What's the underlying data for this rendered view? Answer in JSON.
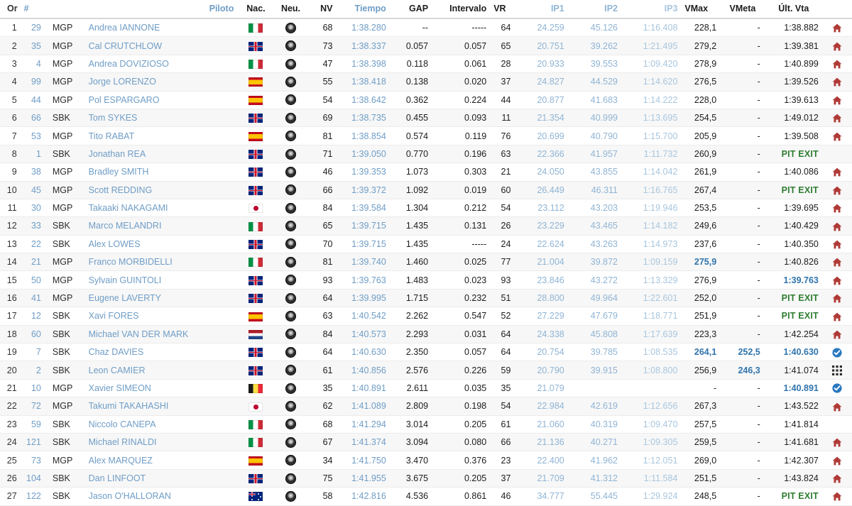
{
  "table": {
    "columns": [
      {
        "key": "or",
        "label": "Or"
      },
      {
        "key": "number",
        "label": "#"
      },
      {
        "key": "category",
        "label": ""
      },
      {
        "key": "pilot",
        "label": "Piloto"
      },
      {
        "key": "nac",
        "label": "Nac."
      },
      {
        "key": "neu",
        "label": "Neu."
      },
      {
        "key": "nv",
        "label": "NV"
      },
      {
        "key": "tiempo",
        "label": "Tiempo"
      },
      {
        "key": "gap",
        "label": "GAP"
      },
      {
        "key": "intervalo",
        "label": "Intervalo"
      },
      {
        "key": "vr",
        "label": "VR"
      },
      {
        "key": "ip1",
        "label": "IP1"
      },
      {
        "key": "ip2",
        "label": "IP2"
      },
      {
        "key": "ip3",
        "label": "IP3"
      },
      {
        "key": "vmax",
        "label": "VMax"
      },
      {
        "key": "vmeta",
        "label": "VMeta"
      },
      {
        "key": "ult",
        "label": "Últ. Vta"
      },
      {
        "key": "status",
        "label": ""
      }
    ],
    "rows": [
      {
        "or": "1",
        "number": "29",
        "category": "MGP",
        "pilot": "Andrea IANNONE",
        "nac": "it",
        "neu": "tyre-icon",
        "nv": "68",
        "tiempo": "1:38.280",
        "gap": "--",
        "intervalo": "-----",
        "vr": "64",
        "ip1": "24.259",
        "ip2": "45.126",
        "ip3": "1:16.408",
        "vmax": "228,1",
        "vmeta": "-",
        "ult": "1:38.882",
        "ult_style": "normal",
        "status": "home-icon"
      },
      {
        "or": "2",
        "number": "35",
        "category": "MGP",
        "pilot": "Cal CRUTCHLOW",
        "nac": "gb",
        "neu": "tyre-icon",
        "nv": "73",
        "tiempo": "1:38.337",
        "gap": "0.057",
        "intervalo": "0.057",
        "vr": "65",
        "ip1": "20.751",
        "ip2": "39.262",
        "ip3": "1:21.495",
        "vmax": "279,2",
        "vmeta": "-",
        "ult": "1:39.381",
        "ult_style": "normal",
        "status": "home-icon"
      },
      {
        "or": "3",
        "number": "4",
        "category": "MGP",
        "pilot": "Andrea DOVIZIOSO",
        "nac": "it",
        "neu": "tyre-icon",
        "nv": "47",
        "tiempo": "1:38.398",
        "gap": "0.118",
        "intervalo": "0.061",
        "vr": "28",
        "ip1": "20.933",
        "ip2": "39.553",
        "ip3": "1:09.420",
        "vmax": "278,9",
        "vmeta": "-",
        "ult": "1:40.899",
        "ult_style": "normal",
        "status": "home-icon"
      },
      {
        "or": "4",
        "number": "99",
        "category": "MGP",
        "pilot": "Jorge LORENZO",
        "nac": "es",
        "neu": "tyre-icon",
        "nv": "55",
        "tiempo": "1:38.418",
        "gap": "0.138",
        "intervalo": "0.020",
        "vr": "37",
        "ip1": "24.827",
        "ip2": "44.529",
        "ip3": "1:14.620",
        "vmax": "276,5",
        "vmeta": "-",
        "ult": "1:39.526",
        "ult_style": "normal",
        "status": "home-icon"
      },
      {
        "or": "5",
        "number": "44",
        "category": "MGP",
        "pilot": "Pol ESPARGARO",
        "nac": "es",
        "neu": "tyre-icon",
        "nv": "54",
        "tiempo": "1:38.642",
        "gap": "0.362",
        "intervalo": "0.224",
        "vr": "44",
        "ip1": "20.877",
        "ip2": "41.683",
        "ip3": "1:14.222",
        "vmax": "228,0",
        "vmeta": "-",
        "ult": "1:39.613",
        "ult_style": "normal",
        "status": "home-icon"
      },
      {
        "or": "6",
        "number": "66",
        "category": "SBK",
        "pilot": "Tom SYKES",
        "nac": "gb",
        "neu": "tyre-icon",
        "nv": "69",
        "tiempo": "1:38.735",
        "gap": "0.455",
        "intervalo": "0.093",
        "vr": "11",
        "ip1": "21.354",
        "ip2": "40.999",
        "ip3": "1:13.695",
        "vmax": "254,5",
        "vmeta": "-",
        "ult": "1:49.012",
        "ult_style": "normal",
        "status": "home-icon"
      },
      {
        "or": "7",
        "number": "53",
        "category": "MGP",
        "pilot": "Tito RABAT",
        "nac": "es",
        "neu": "tyre-icon",
        "nv": "81",
        "tiempo": "1:38.854",
        "gap": "0.574",
        "intervalo": "0.119",
        "vr": "76",
        "ip1": "20.699",
        "ip2": "40.790",
        "ip3": "1:15.700",
        "vmax": "205,9",
        "vmeta": "-",
        "ult": "1:39.508",
        "ult_style": "normal",
        "status": "home-icon"
      },
      {
        "or": "8",
        "number": "1",
        "category": "SBK",
        "pilot": "Jonathan REA",
        "nac": "gb",
        "neu": "tyre-icon",
        "nv": "71",
        "tiempo": "1:39.050",
        "gap": "0.770",
        "intervalo": "0.196",
        "vr": "63",
        "ip1": "22.366",
        "ip2": "41.957",
        "ip3": "1:11.732",
        "vmax": "260,9",
        "vmeta": "-",
        "ult": "PIT EXIT",
        "ult_style": "pit",
        "status": "none"
      },
      {
        "or": "9",
        "number": "38",
        "category": "MGP",
        "pilot": "Bradley SMITH",
        "nac": "gb",
        "neu": "tyre-icon",
        "nv": "46",
        "tiempo": "1:39.353",
        "gap": "1.073",
        "intervalo": "0.303",
        "vr": "21",
        "ip1": "24.050",
        "ip2": "43.855",
        "ip3": "1:14.042",
        "vmax": "261,9",
        "vmeta": "-",
        "ult": "1:40.086",
        "ult_style": "normal",
        "status": "home-icon"
      },
      {
        "or": "10",
        "number": "45",
        "category": "MGP",
        "pilot": "Scott REDDING",
        "nac": "gb",
        "neu": "tyre-icon",
        "nv": "66",
        "tiempo": "1:39.372",
        "gap": "1.092",
        "intervalo": "0.019",
        "vr": "60",
        "ip1": "26.449",
        "ip2": "46.311",
        "ip3": "1:16.765",
        "vmax": "267,4",
        "vmeta": "-",
        "ult": "PIT EXIT",
        "ult_style": "pit",
        "status": "home-icon"
      },
      {
        "or": "11",
        "number": "30",
        "category": "MGP",
        "pilot": "Takaaki NAKAGAMI",
        "nac": "jp",
        "neu": "tyre-icon",
        "nv": "84",
        "tiempo": "1:39.584",
        "gap": "1.304",
        "intervalo": "0.212",
        "vr": "54",
        "ip1": "23.112",
        "ip2": "43.203",
        "ip3": "1:19.946",
        "vmax": "253,5",
        "vmeta": "-",
        "ult": "1:39.695",
        "ult_style": "normal",
        "status": "home-icon"
      },
      {
        "or": "12",
        "number": "33",
        "category": "SBK",
        "pilot": "Marco MELANDRI",
        "nac": "it",
        "neu": "tyre-icon",
        "nv": "65",
        "tiempo": "1:39.715",
        "gap": "1.435",
        "intervalo": "0.131",
        "vr": "26",
        "ip1": "23.229",
        "ip2": "43.465",
        "ip3": "1:14.182",
        "vmax": "249,6",
        "vmeta": "-",
        "ult": "1:40.429",
        "ult_style": "normal",
        "status": "home-icon"
      },
      {
        "or": "13",
        "number": "22",
        "category": "SBK",
        "pilot": "Alex LOWES",
        "nac": "gb",
        "neu": "tyre-icon",
        "nv": "70",
        "tiempo": "1:39.715",
        "gap": "1.435",
        "intervalo": "-----",
        "vr": "24",
        "ip1": "22.624",
        "ip2": "43.263",
        "ip3": "1:14.973",
        "vmax": "237,6",
        "vmeta": "-",
        "ult": "1:40.350",
        "ult_style": "normal",
        "status": "home-icon"
      },
      {
        "or": "14",
        "number": "21",
        "category": "MGP",
        "pilot": "Franco MORBIDELLI",
        "nac": "it",
        "neu": "tyre-icon",
        "nv": "81",
        "tiempo": "1:39.740",
        "gap": "1.460",
        "intervalo": "0.025",
        "vr": "77",
        "ip1": "21.004",
        "ip2": "39.872",
        "ip3": "1:09.159",
        "vmax": "275,9",
        "vmax_style": "bold",
        "vmeta": "-",
        "ult": "1:40.826",
        "ult_style": "normal",
        "status": "home-icon"
      },
      {
        "or": "15",
        "number": "50",
        "category": "MGP",
        "pilot": "Sylvain GUINTOLI",
        "nac": "gb",
        "neu": "tyre-icon",
        "nv": "93",
        "tiempo": "1:39.763",
        "gap": "1.483",
        "intervalo": "0.023",
        "vr": "93",
        "ip1": "23.846",
        "ip2": "43.272",
        "ip3": "1:13.329",
        "vmax": "276,9",
        "vmeta": "-",
        "ult": "1:39.763",
        "ult_style": "bold",
        "status": "home-icon"
      },
      {
        "or": "16",
        "number": "41",
        "category": "MGP",
        "pilot": "Eugene LAVERTY",
        "nac": "gb",
        "neu": "tyre-icon",
        "nv": "64",
        "tiempo": "1:39.995",
        "gap": "1.715",
        "intervalo": "0.232",
        "vr": "51",
        "ip1": "28.800",
        "ip2": "49.964",
        "ip3": "1:22.601",
        "vmax": "252,0",
        "vmeta": "-",
        "ult": "PIT EXIT",
        "ult_style": "pit",
        "status": "home-icon"
      },
      {
        "or": "17",
        "number": "12",
        "category": "SBK",
        "pilot": "Xavi FORES",
        "nac": "es",
        "neu": "tyre-icon",
        "nv": "63",
        "tiempo": "1:40.542",
        "gap": "2.262",
        "intervalo": "0.547",
        "vr": "52",
        "ip1": "27.229",
        "ip2": "47.679",
        "ip3": "1:18.771",
        "vmax": "251,9",
        "vmeta": "-",
        "ult": "PIT EXIT",
        "ult_style": "pit",
        "status": "home-icon"
      },
      {
        "or": "18",
        "number": "60",
        "category": "SBK",
        "pilot": "Michael VAN DER MARK",
        "nac": "nl",
        "neu": "tyre-icon",
        "nv": "84",
        "tiempo": "1:40.573",
        "gap": "2.293",
        "intervalo": "0.031",
        "vr": "64",
        "ip1": "24.338",
        "ip2": "45.808",
        "ip3": "1:17.639",
        "vmax": "223,3",
        "vmeta": "-",
        "ult": "1:42.254",
        "ult_style": "normal",
        "status": "home-icon"
      },
      {
        "or": "19",
        "number": "7",
        "category": "SBK",
        "pilot": "Chaz DAVIES",
        "nac": "gb",
        "neu": "tyre-icon",
        "nv": "64",
        "tiempo": "1:40.630",
        "gap": "2.350",
        "intervalo": "0.057",
        "vr": "64",
        "ip1": "20.754",
        "ip2": "39.785",
        "ip3": "1:08.535",
        "vmax": "264,1",
        "vmax_style": "bold",
        "vmeta": "252,5",
        "vmeta_style": "bold",
        "ult": "1:40.630",
        "ult_style": "bold",
        "status": "check-icon"
      },
      {
        "or": "20",
        "number": "2",
        "category": "SBK",
        "pilot": "Leon CAMIER",
        "nac": "gb",
        "neu": "tyre-icon",
        "nv": "61",
        "tiempo": "1:40.856",
        "gap": "2.576",
        "intervalo": "0.226",
        "vr": "59",
        "ip1": "20.790",
        "ip2": "39.915",
        "ip3": "1:08.800",
        "vmax": "256,9",
        "vmeta": "246,3",
        "vmeta_style": "bold",
        "ult": "1:41.074",
        "ult_style": "normal",
        "status": "grid-icon"
      },
      {
        "or": "21",
        "number": "10",
        "category": "MGP",
        "pilot": "Xavier SIMEON",
        "nac": "be",
        "neu": "tyre-icon",
        "nv": "35",
        "tiempo": "1:40.891",
        "gap": "2.611",
        "intervalo": "0.035",
        "vr": "35",
        "ip1": "21.079",
        "ip2": "",
        "ip3": "",
        "vmax": "-",
        "vmeta": "-",
        "ult": "1:40.891",
        "ult_style": "bold",
        "status": "check-icon"
      },
      {
        "or": "22",
        "number": "72",
        "category": "MGP",
        "pilot": "Takumi TAKAHASHI",
        "nac": "jp",
        "neu": "tyre-icon",
        "nv": "62",
        "tiempo": "1:41.089",
        "gap": "2.809",
        "intervalo": "0.198",
        "vr": "54",
        "ip1": "22.984",
        "ip2": "42.619",
        "ip3": "1:12.656",
        "vmax": "267,3",
        "vmeta": "-",
        "ult": "1:43.522",
        "ult_style": "normal",
        "status": "home-icon"
      },
      {
        "or": "23",
        "number": "59",
        "category": "SBK",
        "pilot": "Niccolo CANEPA",
        "nac": "it",
        "neu": "tyre-icon",
        "nv": "68",
        "tiempo": "1:41.294",
        "gap": "3.014",
        "intervalo": "0.205",
        "vr": "61",
        "ip1": "21.060",
        "ip2": "40.319",
        "ip3": "1:09.470",
        "vmax": "257,5",
        "vmeta": "-",
        "ult": "1:41.814",
        "ult_style": "normal",
        "status": "none"
      },
      {
        "or": "24",
        "number": "121",
        "category": "SBK",
        "pilot": "Michael RINALDI",
        "nac": "it",
        "neu": "tyre-icon",
        "nv": "67",
        "tiempo": "1:41.374",
        "gap": "3.094",
        "intervalo": "0.080",
        "vr": "66",
        "ip1": "21.136",
        "ip2": "40.271",
        "ip3": "1:09.305",
        "vmax": "259,5",
        "vmeta": "-",
        "ult": "1:41.681",
        "ult_style": "normal",
        "status": "home-icon"
      },
      {
        "or": "25",
        "number": "73",
        "category": "MGP",
        "pilot": "Alex MARQUEZ",
        "nac": "es",
        "neu": "tyre-icon",
        "nv": "34",
        "tiempo": "1:41.750",
        "gap": "3.470",
        "intervalo": "0.376",
        "vr": "23",
        "ip1": "22.400",
        "ip2": "41.962",
        "ip3": "1:12.051",
        "vmax": "269,0",
        "vmeta": "-",
        "ult": "1:42.307",
        "ult_style": "normal",
        "status": "home-icon"
      },
      {
        "or": "26",
        "number": "104",
        "category": "SBK",
        "pilot": "Dan LINFOOT",
        "nac": "gb",
        "neu": "tyre-icon",
        "nv": "75",
        "tiempo": "1:41.955",
        "gap": "3.675",
        "intervalo": "0.205",
        "vr": "37",
        "ip1": "21.709",
        "ip2": "41.312",
        "ip3": "1:11.584",
        "vmax": "251,5",
        "vmeta": "-",
        "ult": "1:43.824",
        "ult_style": "normal",
        "status": "home-icon"
      },
      {
        "or": "27",
        "number": "122",
        "category": "SBK",
        "pilot": "Jason O'HALLORAN",
        "nac": "au",
        "neu": "tyre-icon",
        "nv": "58",
        "tiempo": "1:42.816",
        "gap": "4.536",
        "intervalo": "0.861",
        "vr": "46",
        "ip1": "34.777",
        "ip2": "55.445",
        "ip3": "1:29.924",
        "vmax": "248,5",
        "vmeta": "-",
        "ult": "PIT EXIT",
        "ult_style": "pit",
        "status": "home-icon"
      }
    ]
  },
  "colors": {
    "link_blue": "#6f9dc6",
    "sector_blue": "#8fb4d4",
    "highlight_blue": "#2f74ad",
    "pit_exit_green": "#2e7d32",
    "home_icon_red": "#b03a36",
    "check_icon_blue": "#2a79bf",
    "row_alt_bg": "#f7f7f7"
  }
}
